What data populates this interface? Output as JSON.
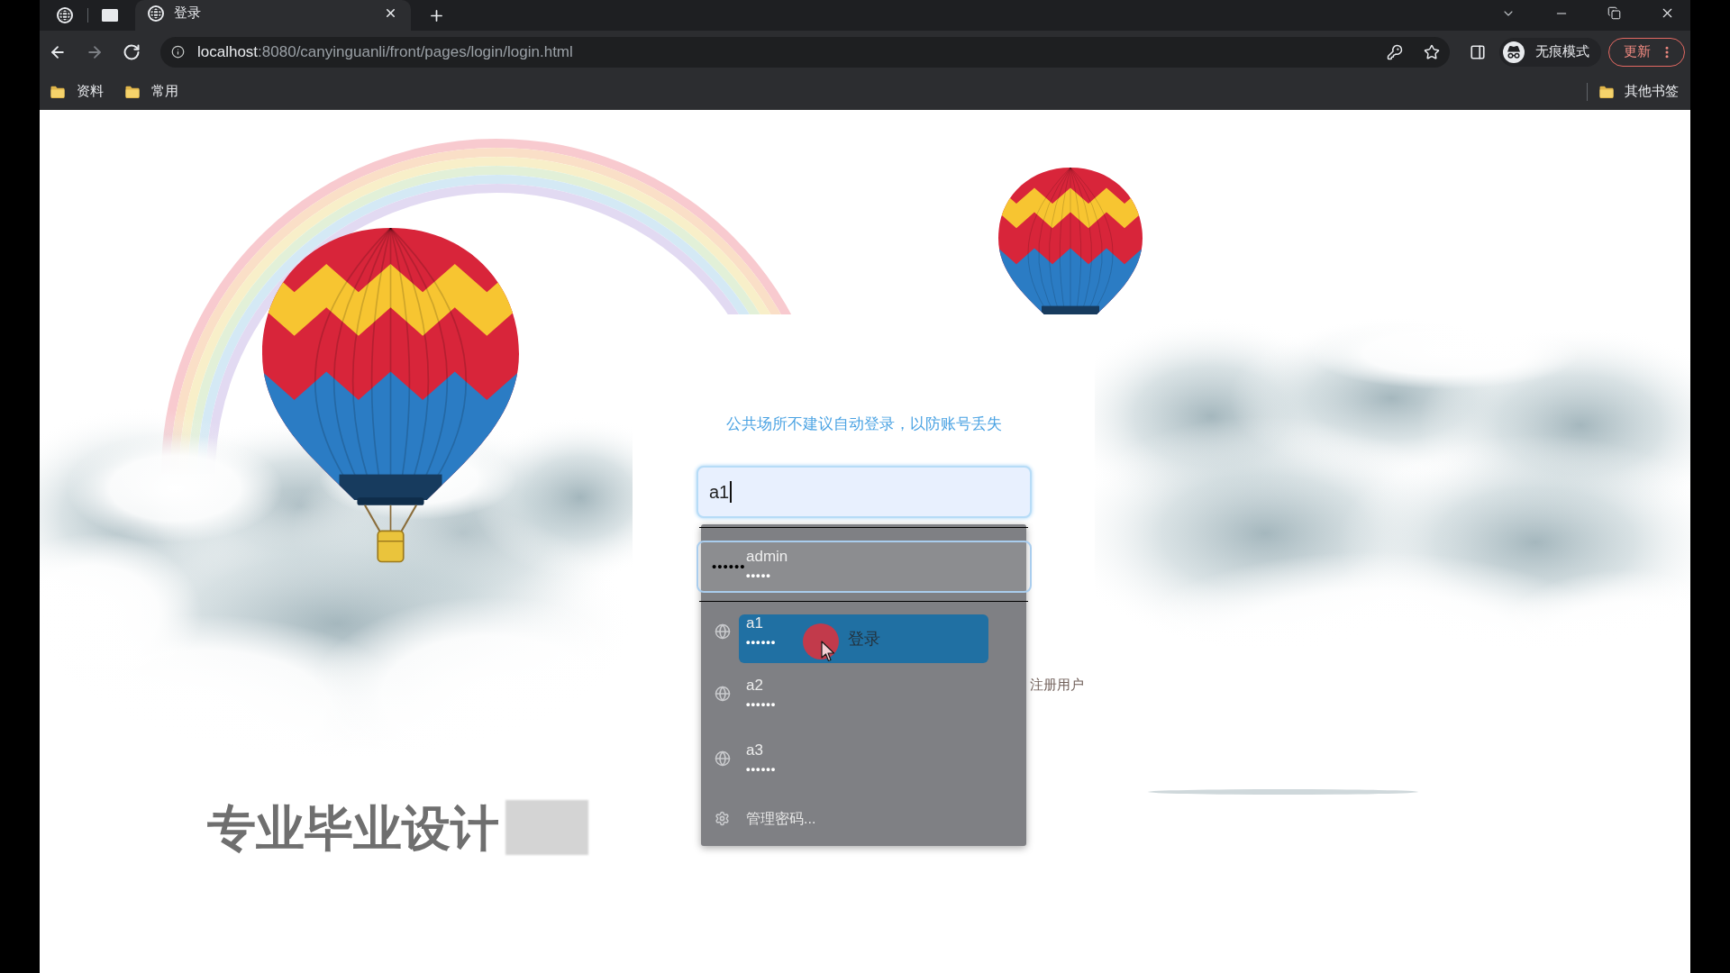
{
  "browser": {
    "tabs": [
      {
        "title": "登录",
        "selected": true
      }
    ],
    "url_host": "localhost",
    "url_rest": ":8080/canyinguanli/front/pages/login/login.html",
    "incognito_label": "无痕模式",
    "update_button": "更新",
    "bookmarks": [
      {
        "label": "资料"
      },
      {
        "label": "常用"
      }
    ],
    "other_bookmarks": "其他书签"
  },
  "login": {
    "notice": "公共场所不建议自动登录，以防账号丢失",
    "username": {
      "value": "a1"
    },
    "password": {
      "value": "••••••"
    },
    "login_button": "登录",
    "register_link": "注册用户"
  },
  "autofill": {
    "suggestions": [
      {
        "username": "admin",
        "password": "•••••"
      },
      {
        "username": "a1",
        "password": "••••••"
      },
      {
        "username": "a2",
        "password": "••••••"
      },
      {
        "username": "a3",
        "password": "••••••"
      }
    ],
    "manage_link": "管理密码..."
  },
  "site_title": "专业毕业设计"
}
